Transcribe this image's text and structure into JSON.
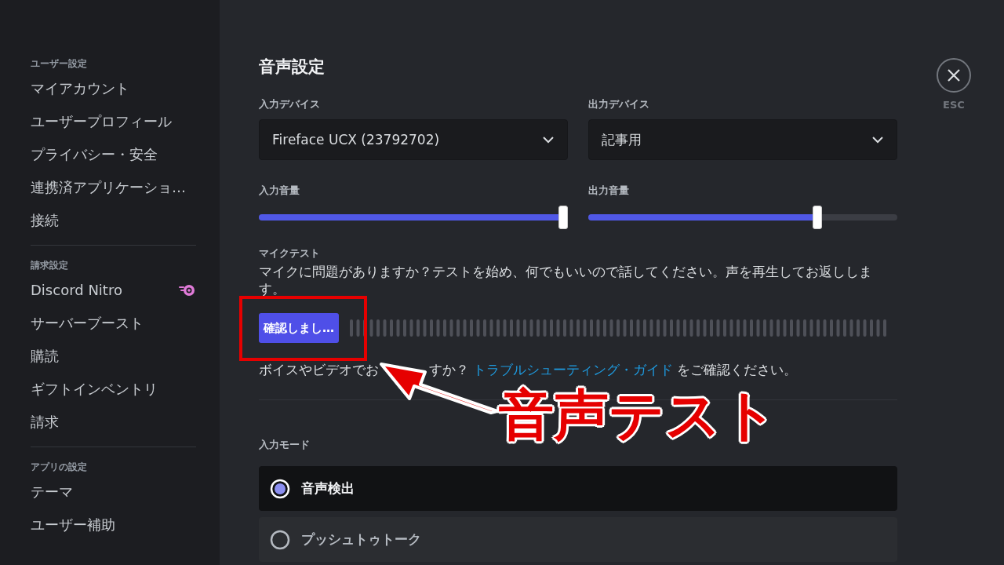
{
  "sidebar": {
    "sections": [
      {
        "header": "ユーザー設定",
        "items": [
          {
            "label": "マイアカウント",
            "kind": "plain"
          },
          {
            "label": "ユーザープロフィール",
            "kind": "plain"
          },
          {
            "label": "プライバシー・安全",
            "kind": "plain"
          },
          {
            "label": "連携済アプリケーショ…",
            "kind": "plain"
          },
          {
            "label": "接続",
            "kind": "plain"
          }
        ]
      },
      {
        "header": "請求設定",
        "items": [
          {
            "label": "Discord Nitro",
            "kind": "nitro"
          },
          {
            "label": "サーバーブースト",
            "kind": "plain"
          },
          {
            "label": "購読",
            "kind": "plain"
          },
          {
            "label": "ギフトインベントリ",
            "kind": "plain"
          },
          {
            "label": "請求",
            "kind": "plain"
          }
        ]
      },
      {
        "header": "アプリの設定",
        "items": [
          {
            "label": "テーマ",
            "kind": "plain"
          },
          {
            "label": "ユーザー補助",
            "kind": "plain"
          }
        ]
      }
    ]
  },
  "main": {
    "title": "音声設定",
    "devices": [
      {
        "label": "入力デバイス",
        "value": "Fireface UCX (23792702)"
      },
      {
        "label": "出力デバイス",
        "value": "記事用"
      }
    ],
    "volumes": [
      {
        "label": "入力音量",
        "level": 0.985
      },
      {
        "label": "出力音量",
        "level": 0.74
      }
    ],
    "mic_test": {
      "label": "マイクテスト",
      "description": "マイクに問題がありますか？テストを始め、何でもいいので話してください。声を再生してお返しします。",
      "button": "確認しまし…"
    },
    "help": {
      "text": "ボイスやビデオでお",
      "text_end": "すか？",
      "link": "トラブルシューティング・ガイド",
      "suffix": "をご確認ください。"
    },
    "input_mode": {
      "label": "入力モード",
      "options": [
        {
          "label": "音声検出",
          "selected": true
        },
        {
          "label": "プッシュトゥトーク",
          "selected": false
        }
      ]
    }
  },
  "close": {
    "label": "ESC"
  },
  "annotation": {
    "text": "音声テスト"
  }
}
